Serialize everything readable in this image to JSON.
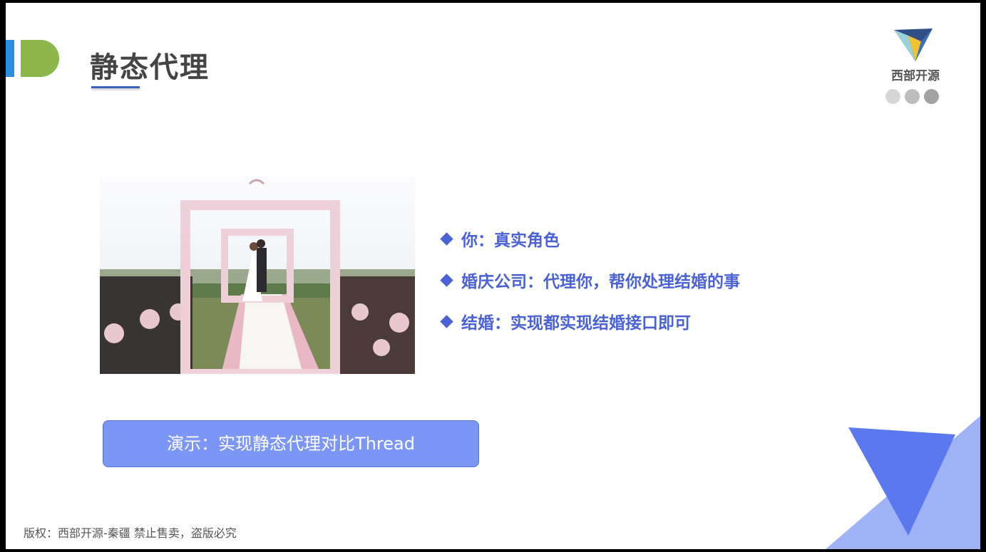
{
  "slide": {
    "title": "静态代理",
    "logo_text": "西部开源",
    "photo_icon": "wedding-ceremony-photo",
    "bullets": [
      "你：真实角色",
      "婚庆公司：代理你，帮你处理结婚的事",
      "结婚：实现都实现结婚接口即可"
    ],
    "demo_button": "演示：实现静态代理对比Thread",
    "copyright": "版权：西部开源-秦疆    禁止售卖，盗版必究"
  },
  "colors": {
    "accent_blue": "#2a8de0",
    "accent_green": "#8ab64a",
    "bullet_text": "#4a62d6",
    "button_bg": "#7b96f4",
    "dots": [
      "#d6d6d6",
      "#bdbdbd",
      "#a2a2a2"
    ]
  }
}
